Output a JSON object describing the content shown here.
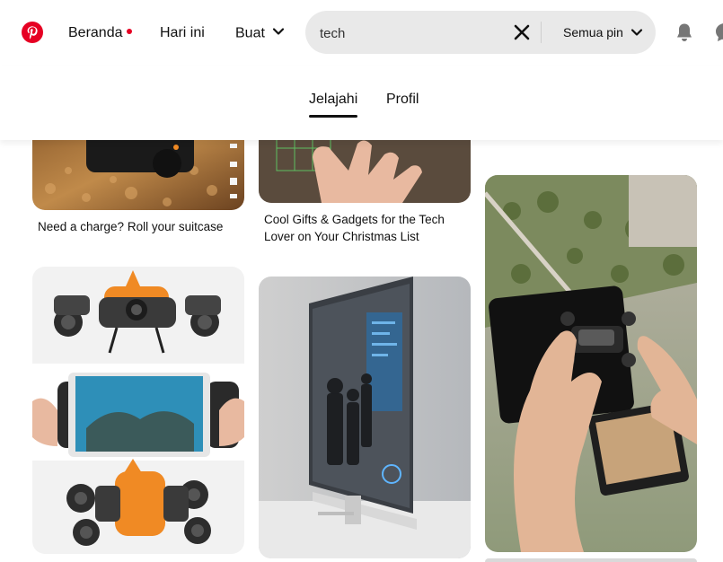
{
  "header": {
    "nav": [
      {
        "label": "Beranda"
      },
      {
        "label": "Hari ini"
      },
      {
        "label": "Buat"
      }
    ],
    "search": {
      "value": "tech",
      "scope_label": "Semua pin"
    },
    "icons": [
      "pinterest-logo-icon",
      "chevron-down-icon",
      "close-icon",
      "bell-icon",
      "chat-icon"
    ],
    "accent_color": "#e60023"
  },
  "tabs": [
    {
      "label": "Jelajahi",
      "active": true
    },
    {
      "label": "Profil",
      "active": false
    }
  ],
  "pins": [
    {
      "title": "Need a charge? Roll your suitcase"
    },
    {
      "title": "Cool Gifts & Gadgets for the Tech Lover on Your Christmas List"
    },
    {
      "title": ""
    },
    {
      "title": ""
    },
    {
      "title": ""
    }
  ]
}
